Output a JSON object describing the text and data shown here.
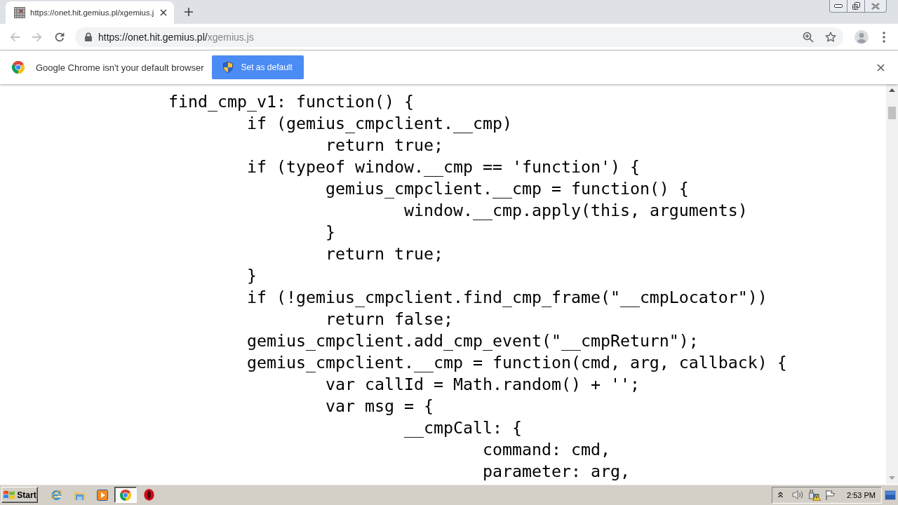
{
  "tabs": [
    {
      "title": "https://onet.hit.gemius.pl/xgemius.j",
      "selected": true
    }
  ],
  "toolbar": {
    "nav_buttons": [
      {
        "kind": "back",
        "disabled": true
      },
      {
        "kind": "forward",
        "disabled": true
      },
      {
        "kind": "reload",
        "disabled": false
      }
    ],
    "address_bar": {
      "url_origin": "https://onet.hit.gemius.pl/",
      "url_path": "xgemius.js"
    }
  },
  "infobar": {
    "message": "Google Chrome isn't your default browser",
    "button": "Set as default"
  },
  "code_lines": [
    {
      "text": "find_cmp_v1: function() {",
      "children": [
        {
          "text": "if (gemius_cmpclient.__cmp)",
          "children": [
            {
              "text": "return true;"
            }
          ]
        },
        {
          "text": "if (typeof window.__cmp == 'function') {",
          "children": [
            {
              "text": "gemius_cmpclient.__cmp = function() {",
              "children": [
                {
                  "text": "window.__cmp.apply(this, arguments)"
                }
              ]
            },
            {
              "text": "}"
            },
            {
              "text": "return true;"
            }
          ]
        },
        {
          "text": "}"
        },
        {
          "text": "if (!gemius_cmpclient.find_cmp_frame(\"__cmpLocator\"))",
          "children": [
            {
              "text": "return false;"
            }
          ]
        },
        {
          "text": "gemius_cmpclient.add_cmp_event(\"__cmpReturn\");"
        },
        {
          "text": "gemius_cmpclient.__cmp = function(cmd, arg, callback) {",
          "children": [
            {
              "text": "var callId = Math.random() + '';"
            },
            {
              "text": "var msg = {",
              "children": [
                {
                  "text": "__cmpCall: {",
                  "children": [
                    {
                      "text": "command: cmd,"
                    },
                    {
                      "text": "parameter: arg,"
                    }
                  ]
                }
              ]
            }
          ]
        }
      ]
    }
  ],
  "taskbar": {
    "start_label": "Start",
    "apps": [
      {
        "kind": "ie",
        "selected": false
      },
      {
        "kind": "folder",
        "selected": false
      },
      {
        "kind": "media",
        "selected": false
      },
      {
        "kind": "chrome",
        "selected": true
      },
      {
        "kind": "opera",
        "selected": false
      }
    ],
    "clock": "2:53 PM"
  }
}
